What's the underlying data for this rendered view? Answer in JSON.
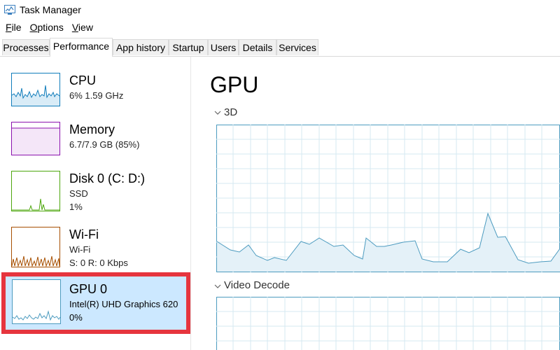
{
  "window": {
    "title": "Task Manager"
  },
  "menu": [
    "File",
    "Options",
    "View"
  ],
  "tabs": [
    "Processes",
    "Performance",
    "App history",
    "Startup",
    "Users",
    "Details",
    "Services"
  ],
  "active_tab": "Performance",
  "sidebar": {
    "cpu": {
      "name": "CPU",
      "line1": "6%  1.59 GHz"
    },
    "memory": {
      "name": "Memory",
      "line1": "6.7/7.9 GB (85%)"
    },
    "disk": {
      "name": "Disk 0 (C: D:)",
      "line1": "SSD",
      "line2": "1%"
    },
    "wifi": {
      "name": "Wi-Fi",
      "line1": "Wi-Fi",
      "line2": "S: 0  R: 0 Kbps"
    },
    "gpu": {
      "name": "GPU 0",
      "line1": "Intel(R) UHD Graphics 620",
      "line2": "0%"
    }
  },
  "main": {
    "title": "GPU",
    "section_3d": "3D",
    "section_video_decode": "Video Decode"
  },
  "colors": {
    "cpu_graph": "#117dbb",
    "memory_graph": "#8b12ae",
    "disk_graph": "#4da60c",
    "wifi_graph": "#a74f01",
    "gpu_graph": "#4c9bbf",
    "selection_bg": "#cce8ff",
    "highlight_border": "#e6353e"
  }
}
